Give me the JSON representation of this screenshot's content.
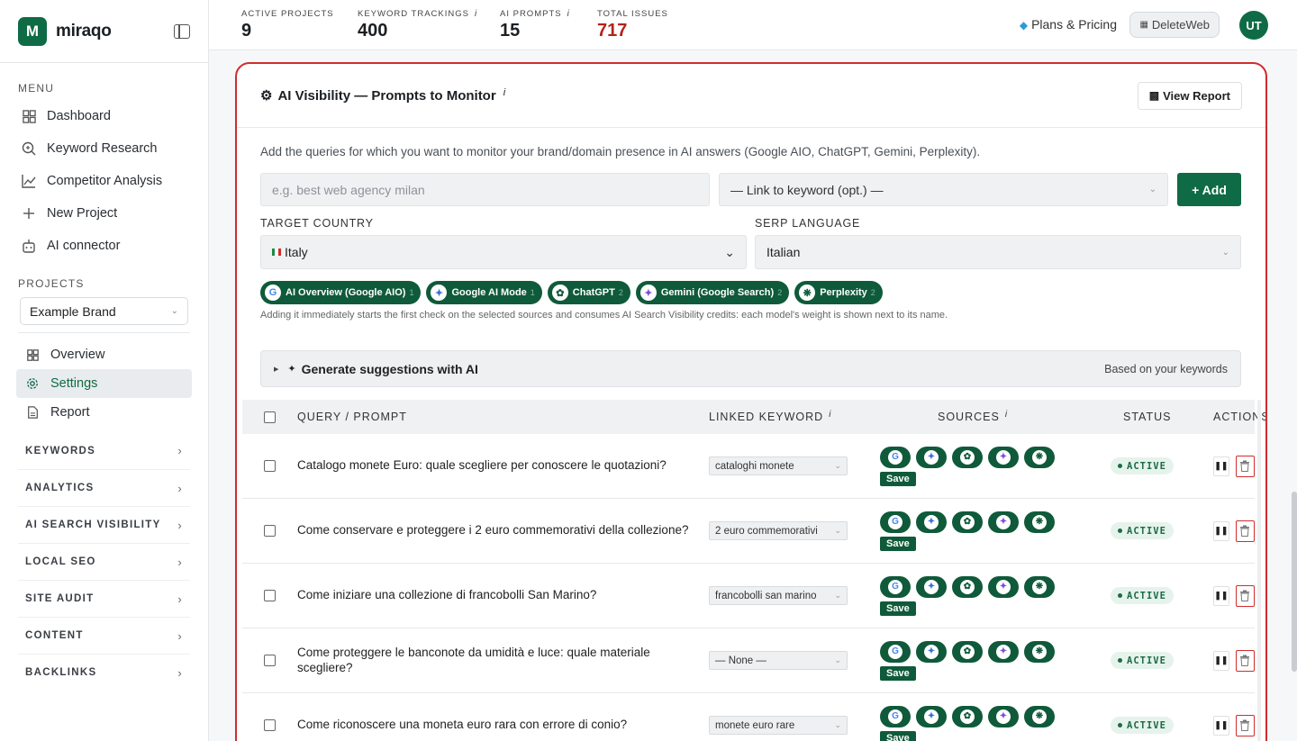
{
  "brand": {
    "name": "miraqo",
    "logo_letter": "M"
  },
  "sidebar": {
    "menu_label": "MENU",
    "menu": [
      {
        "label": "Dashboard",
        "icon": "grid-icon"
      },
      {
        "label": "Keyword Research",
        "icon": "search-icon"
      },
      {
        "label": "Competitor Analysis",
        "icon": "chart-line-icon"
      },
      {
        "label": "New Project",
        "icon": "plus-icon"
      },
      {
        "label": "AI connector",
        "icon": "robot-icon"
      }
    ],
    "projects_label": "PROJECTS",
    "project_selected": "Example Brand",
    "project_nav": [
      {
        "label": "Overview",
        "icon": "grid-icon"
      },
      {
        "label": "Settings",
        "icon": "gear-icon",
        "active": true
      },
      {
        "label": "Report",
        "icon": "document-icon"
      }
    ],
    "groups": [
      "KEYWORDS",
      "ANALYTICS",
      "AI SEARCH VISIBILITY",
      "LOCAL SEO",
      "SITE AUDIT",
      "CONTENT",
      "BACKLINKS"
    ]
  },
  "topbar": {
    "stats": [
      {
        "label": "ACTIVE PROJECTS",
        "value": "9",
        "info": false
      },
      {
        "label": "KEYWORD TRACKINGS",
        "value": "400",
        "info": true
      },
      {
        "label": "AI PROMPTS",
        "value": "15",
        "info": true
      },
      {
        "label": "TOTAL ISSUES",
        "value": "717",
        "info": false,
        "accent": "#b42318"
      }
    ],
    "plans_label": "Plans & Pricing",
    "workspace_label": "DeleteWeb",
    "avatar_initials": "UT"
  },
  "panel": {
    "title": "AI Visibility — Prompts to Monitor",
    "view_report_label": "View Report",
    "intro": "Add the queries for which you want to monitor your brand/domain presence in AI answers (Google AIO, ChatGPT, Gemini, Perplexity).",
    "query_placeholder": "e.g. best web agency milan",
    "keyword_link_value": "— Link to keyword (opt.) —",
    "add_label": "+ Add",
    "target_country_label": "TARGET COUNTRY",
    "target_country_value": "Italy",
    "serp_language_label": "SERP LANGUAGE",
    "serp_language_value": "Italian",
    "sources": [
      {
        "label": "AI Overview (Google AIO)",
        "weight": "1",
        "icon": "google-icon"
      },
      {
        "label": "Google AI Mode",
        "weight": "1",
        "icon": "ai-mode-icon"
      },
      {
        "label": "ChatGPT",
        "weight": "2",
        "icon": "chatgpt-icon"
      },
      {
        "label": "Gemini (Google Search)",
        "weight": "2",
        "icon": "gemini-icon"
      },
      {
        "label": "Perplexity",
        "weight": "2",
        "icon": "perplexity-icon"
      }
    ],
    "note": "Adding it immediately starts the first check on the selected sources and consumes AI Search Visibility credits: each model's weight is shown next to its name.",
    "suggestions_title": "Generate suggestions with AI",
    "suggestions_right": "Based on your keywords"
  },
  "table": {
    "headers": {
      "query": "QUERY / PROMPT",
      "keyword": "LINKED KEYWORD",
      "sources": "SOURCES",
      "status": "STATUS",
      "actions": "ACTIONS"
    },
    "save_label": "Save",
    "rows": [
      {
        "query": "Catalogo monete Euro: quale scegliere per conoscere le quotazioni?",
        "keyword": "cataloghi monete",
        "status": "ACTIVE"
      },
      {
        "query": "Come conservare e proteggere i 2 euro commemorativi della collezione?",
        "keyword": "2 euro commemorativi",
        "status": "ACTIVE"
      },
      {
        "query": "Come iniziare una collezione di francobolli San Marino?",
        "keyword": "francobolli san marino",
        "status": "ACTIVE"
      },
      {
        "query": "Come proteggere le banconote da umidità e luce: quale materiale scegliere?",
        "keyword": "— None —",
        "status": "ACTIVE"
      },
      {
        "query": "Come riconoscere una moneta euro rara con errore di conio?",
        "keyword": "monete euro rare",
        "status": "ACTIVE"
      }
    ]
  },
  "colors": {
    "brand_green": "#0f6b45",
    "highlight_border": "#d12c2c",
    "issues_red": "#b42318"
  }
}
